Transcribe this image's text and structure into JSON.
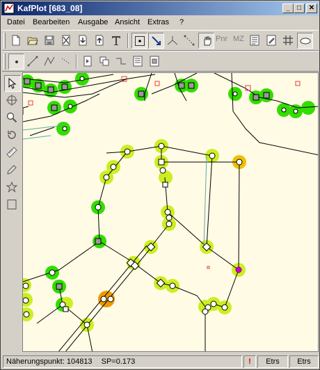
{
  "window": {
    "title": "KafPlot [683_08]",
    "minimize_glyph": "_",
    "maximize_glyph": "□",
    "close_glyph": "✕"
  },
  "menu": [
    "Datei",
    "Bearbeiten",
    "Ausgabe",
    "Ansicht",
    "Extras",
    "?"
  ],
  "toolbar1": {
    "tools": [
      "new-icon",
      "open-icon",
      "save-icon",
      "delete-icon",
      "import-icon",
      "export-icon",
      "text-icon",
      "select-point-icon",
      "arrow-icon",
      "angle-icon",
      "dash-line-icon",
      "hand-icon",
      "pnr-icon",
      "mz-icon",
      "list-icon",
      "edit-icon",
      "grid-icon",
      "ellipse-icon"
    ],
    "pnr_label": "Pnr",
    "mz_label": "MZ"
  },
  "toolbar2": {
    "tools": [
      "point-icon",
      "line-icon",
      "polyline-icon",
      "dotted-icon",
      "insert-icon",
      "copy-shape-icon",
      "step-line-icon",
      "document-icon",
      "report-icon"
    ]
  },
  "sidetools": [
    "pointer-icon",
    "crosshair-icon",
    "zoom-icon",
    "rotate-icon",
    "ruler-icon",
    "pencil-icon",
    "star-icon",
    "rectangle-icon"
  ],
  "colors": {
    "canvas_bg": "#fffbe5",
    "green_halo": "#33dd00",
    "yellowgreen_halo": "#ccee22",
    "orange_halo": "#ee9900",
    "yellow_halo": "#f0c000",
    "selected_point": "#cc00cc",
    "cyan_line": "#5fa8a8",
    "red_outline": "#e04040"
  },
  "status": {
    "main_label": "Näherungspunkt:",
    "main_value": "104813",
    "sp_label": "SP=0.173",
    "alert": "!",
    "etrs1": "Etrs",
    "etrs2": "Etrs"
  }
}
